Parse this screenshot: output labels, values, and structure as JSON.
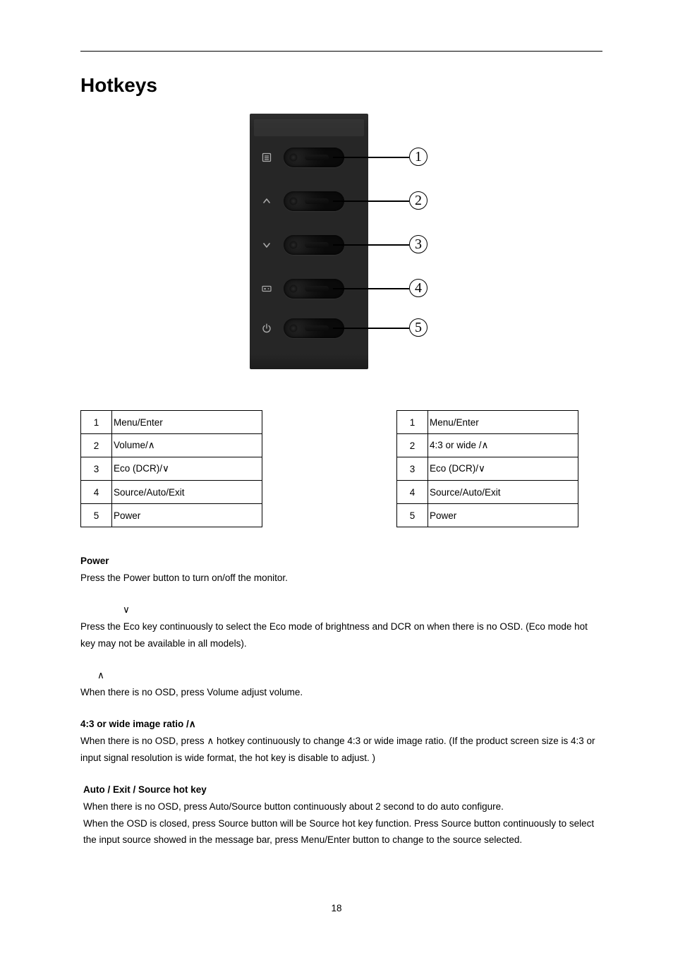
{
  "title": "Hotkeys",
  "diagram": {
    "callouts": [
      "1",
      "2",
      "3",
      "4",
      "5"
    ],
    "rows": [
      {
        "icon": "menu-icon"
      },
      {
        "icon": "caret-up-icon"
      },
      {
        "icon": "caret-down-icon"
      },
      {
        "icon": "source-icon"
      },
      {
        "icon": "power-icon"
      }
    ]
  },
  "left_table": [
    {
      "n": "1",
      "label": "Menu/Enter"
    },
    {
      "n": "2",
      "label": "Volume/∧"
    },
    {
      "n": "3",
      "label": "Eco (DCR)/∨"
    },
    {
      "n": "4",
      "label": "Source/Auto/Exit"
    },
    {
      "n": "5",
      "label": "Power"
    }
  ],
  "right_table": [
    {
      "n": "1",
      "label": "Menu/Enter"
    },
    {
      "n": "2",
      "label": "4:3 or wide /∧"
    },
    {
      "n": "3",
      "label": "Eco (DCR)/∨"
    },
    {
      "n": "4",
      "label": "Source/Auto/Exit"
    },
    {
      "n": "5",
      "label": "Power"
    }
  ],
  "sections": {
    "power": {
      "heading": "Power",
      "body": "Press the Power button to turn on/off the monitor."
    },
    "eco": {
      "heading_prefix": "",
      "symbol": "∨",
      "body": "Press the Eco key continuously to select the Eco mode of brightness and DCR on when there is no OSD. (Eco mode hot key may not be available in all models)."
    },
    "volume": {
      "symbol": "∧",
      "body": "When there is no OSD, press Volume adjust volume."
    },
    "ratio": {
      "heading": "4:3 or wide image ratio /∧",
      "body": "When there is no OSD, press ∧ hotkey continuously to change 4:3 or wide image ratio. (If the product screen size is 4:3 or input signal resolution is wide format, the hot key is disable to adjust. )"
    },
    "auto": {
      "heading": "Auto / Exit / Source hot key",
      "body1": "When there is no OSD, press Auto/Source button continuously about 2 second to do auto configure.",
      "body2": "When the OSD is closed, press Source button will be Source hot key function. Press Source button continuously to select the input source showed in the message bar, press Menu/Enter button to change to the source selected."
    }
  },
  "page_number": "18"
}
